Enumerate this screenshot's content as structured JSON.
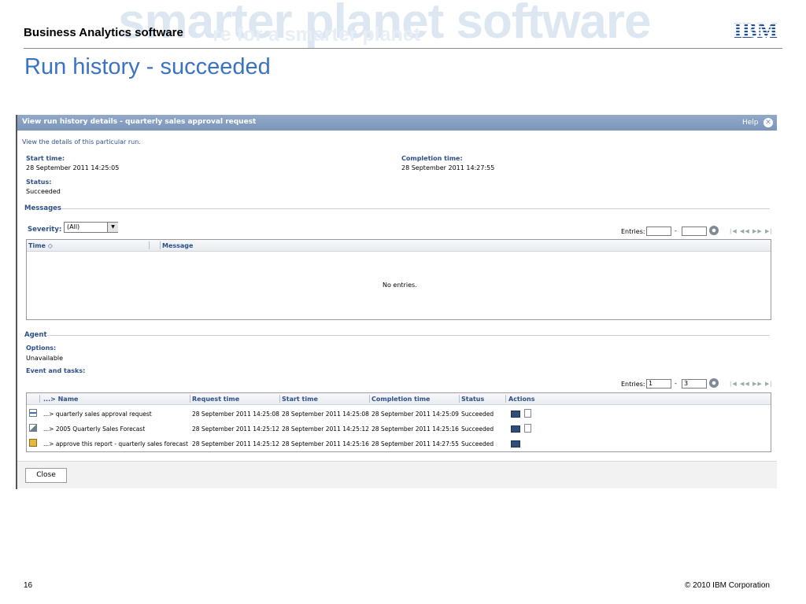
{
  "slide": {
    "header_title": "Business Analytics software",
    "watermark_big": "smarter planet software",
    "watermark_small": "re for a smarter planet",
    "logo_text": "IBM",
    "title": "Run history - succeeded",
    "page_number": "16",
    "copyright": "© 2010 IBM Corporation"
  },
  "window": {
    "title": "View run history details - quarterly sales approval request",
    "help": "Help",
    "close_glyph": "✕",
    "description": "View the details of this particular run.",
    "start_time_label": "Start time:",
    "start_time": "28 September 2011 14:25:05",
    "completion_time_label": "Completion time:",
    "completion_time": "28 September 2011 14:27:55",
    "status_label": "Status:",
    "status": "Succeeded"
  },
  "messages": {
    "section": "Messages",
    "severity_label": "Severity:",
    "severity_value": "(All)",
    "entries_label": "Entries:",
    "entries_from": "",
    "entries_dash": "-",
    "entries_to": "",
    "pager": "|◀ ◀◀ ▶▶ ▶|",
    "col_time": "Time ◇",
    "col_message": "Message",
    "empty": "No entries."
  },
  "agent": {
    "section": "Agent",
    "options_label": "Options:",
    "options_value": "Unavailable",
    "events_label": "Event and tasks:",
    "entries_label": "Entries:",
    "entries_from": "1",
    "entries_dash": "-",
    "entries_to": "3",
    "pager": "|◀ ◀◀ ▶▶ ▶|",
    "columns": [
      "...> Name",
      "Request time",
      "Start time",
      "Completion time",
      "Status",
      "Actions"
    ],
    "rows": [
      {
        "name": "...> quarterly sales approval request",
        "request": "28 September 2011 14:25:08",
        "start": "28 September 2011 14:25:08",
        "completion": "28 September 2011 14:25:09",
        "status": "Succeeded",
        "icon": "job-icon"
      },
      {
        "name": "...> 2005 Quarterly Sales Forecast",
        "request": "28 September 2011 14:25:12",
        "start": "28 September 2011 14:25:12",
        "completion": "28 September 2011 14:25:16",
        "status": "Succeeded",
        "icon": "report-icon"
      },
      {
        "name": "...> approve this report - quarterly sales forecast",
        "request": "28 September 2011 14:25:12",
        "start": "28 September 2011 14:25:16",
        "completion": "28 September 2011 14:27:55",
        "status": "Succeeded",
        "icon": "approval-task-icon"
      }
    ]
  },
  "footer": {
    "close_button": "Close"
  },
  "colors": {
    "title_blue": "#3a72c4",
    "titlebar": "#7b95bb",
    "label_blue": "#2d4f8a",
    "ibm_blue": "#1f4f9c"
  }
}
